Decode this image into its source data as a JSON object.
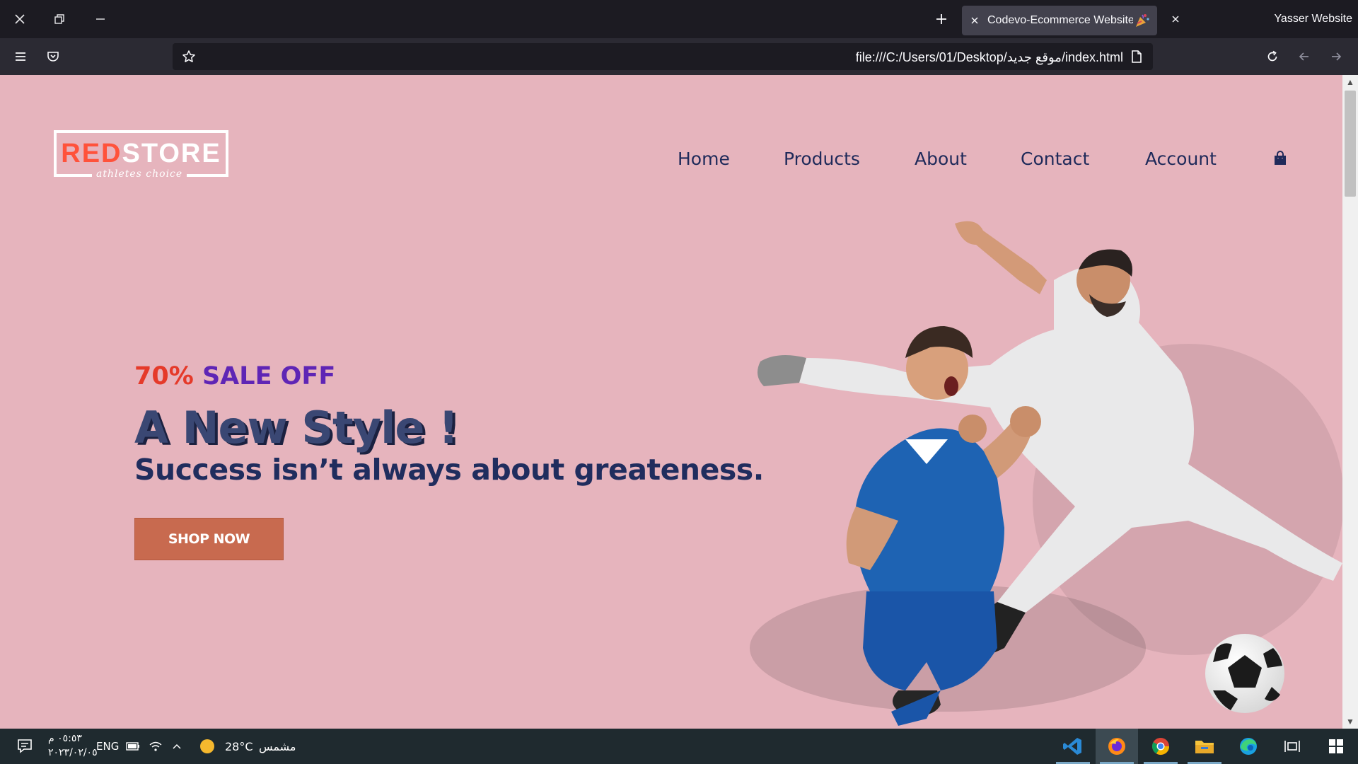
{
  "browser": {
    "active_tab": {
      "title": "Codevo-Ecommerce Website"
    },
    "other_tab": {
      "title": "Yasser Website"
    },
    "url": "file:///C:/Users/01/Desktop/موقع جديد/index.html"
  },
  "site": {
    "logo": {
      "text_red": "RED",
      "text_white": "STORE",
      "tagline": "athletes choice"
    },
    "nav": {
      "home": "Home",
      "products": "Products",
      "about": "About",
      "contact": "Contact",
      "account": "Account"
    },
    "hero": {
      "sale_pct": "70%",
      "sale_text": "SALE OFF",
      "headline": "A New Style !",
      "subline": "Success isn’t always about greateness.",
      "button": "SHOP NOW"
    },
    "colors": {
      "background": "#e6b4bd",
      "accent": "#ff523b",
      "button": "#c86a4f",
      "navy": "#1f2a5a"
    }
  },
  "taskbar": {
    "time": "٠٥:٥٣ م",
    "date": "٢٠٢٣/٠٢/٠٥",
    "language": "ENG",
    "temperature": "28°C",
    "weather": "مشمس"
  }
}
